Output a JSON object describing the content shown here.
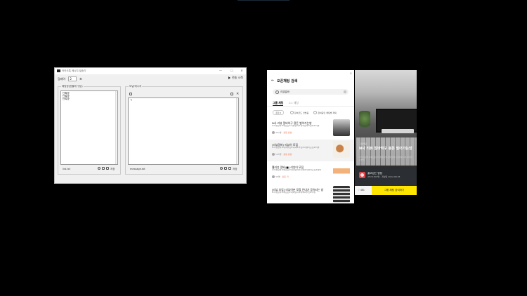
{
  "app": {
    "title": "카카오톡 메시지 발송기",
    "buttons": {
      "minimize": "—",
      "maximize": "☐",
      "close": "✕"
    },
    "interval_label": "딜레이",
    "interval_value": "2",
    "interval_unit": "초",
    "start_label": "전송 시작",
    "rooms_group_label": "채팅방(한줄에 구분)",
    "rooms": [
      "단톡방",
      "단톡방",
      "단톡방"
    ],
    "rooms_file": "list.txt",
    "message_group_label": "보낼 메시지",
    "message_text": "ㅋ",
    "message_file": "message.txt",
    "save_label": "저장"
  },
  "panel": {
    "title": "오픈채팅 검색",
    "search_value": "리뷰알바",
    "tabs": [
      "그룹 채팅",
      "1:1 채팅"
    ],
    "filters": {
      "sort": "추천",
      "option1": "참여코드 안받음",
      "option2": "참여중인 채팅방 제외"
    },
    "results": [
      {
        "title": "N사 리뷰 알바하구 용돈 벌어가는방",
        "desc": "#리뷰알바#체험단#리뷰알바#재택알바#알바#리뷰",
        "meta": "457명",
        "hot": "· 활동 활발"
      },
      {
        "title": "(리뷰알바) 리뷰어 모집",
        "desc": "#리뷰알바#재택부업#재택#부업#리뷰어모집#리뷰",
        "meta": "145명",
        "hot": "· 활동 활발"
      },
      {
        "title": "웰리뷰 알바(■) 리뷰어 모집",
        "desc": "#리뷰알바#체험단#재택알바#리뷰#리뷰어모집#알바",
        "meta": "35명",
        "hot": "· 활동 적"
      },
      {
        "title": "[리뷰 부업] 리뷰어분 모집 안내가 공유되는 방",
        "desc": "#리뷰알바#체험단#재택알바#재택#부업#리뷰",
        "meta": "",
        "hot": ""
      }
    ]
  },
  "card": {
    "badge": "그룹채팅",
    "title": "N사 리뷰 알바하구 용돈 벌어가는방",
    "desc": "#리뷰알바#체험단#리뷰알바#재택알바#알바#리뷰#재택#부업",
    "owner": "꿀고있는 방장",
    "owner_meta": "457/1500명 · 개설일 2022.08.25",
    "likes": "♡ 461",
    "join_label": "그룹 채팅 참여하기",
    "colors": {
      "join": "#fee500"
    }
  }
}
